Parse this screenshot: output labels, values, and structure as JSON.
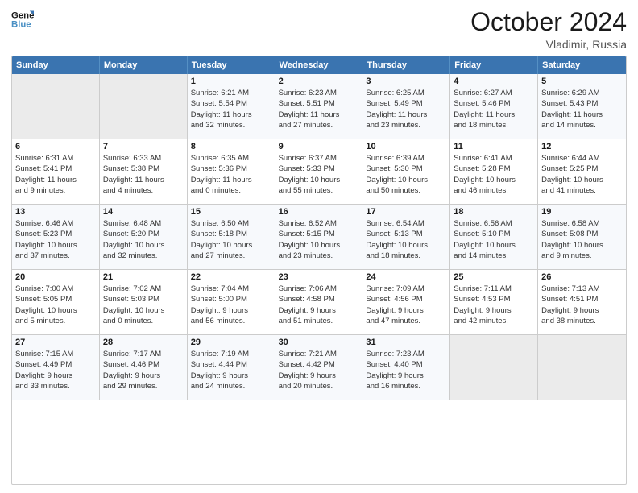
{
  "header": {
    "logo_line1": "General",
    "logo_line2": "Blue",
    "month": "October 2024",
    "location": "Vladimir, Russia"
  },
  "weekdays": [
    "Sunday",
    "Monday",
    "Tuesday",
    "Wednesday",
    "Thursday",
    "Friday",
    "Saturday"
  ],
  "weeks": [
    [
      {
        "day": "",
        "info": ""
      },
      {
        "day": "",
        "info": ""
      },
      {
        "day": "1",
        "info": "Sunrise: 6:21 AM\nSunset: 5:54 PM\nDaylight: 11 hours\nand 32 minutes."
      },
      {
        "day": "2",
        "info": "Sunrise: 6:23 AM\nSunset: 5:51 PM\nDaylight: 11 hours\nand 27 minutes."
      },
      {
        "day": "3",
        "info": "Sunrise: 6:25 AM\nSunset: 5:49 PM\nDaylight: 11 hours\nand 23 minutes."
      },
      {
        "day": "4",
        "info": "Sunrise: 6:27 AM\nSunset: 5:46 PM\nDaylight: 11 hours\nand 18 minutes."
      },
      {
        "day": "5",
        "info": "Sunrise: 6:29 AM\nSunset: 5:43 PM\nDaylight: 11 hours\nand 14 minutes."
      }
    ],
    [
      {
        "day": "6",
        "info": "Sunrise: 6:31 AM\nSunset: 5:41 PM\nDaylight: 11 hours\nand 9 minutes."
      },
      {
        "day": "7",
        "info": "Sunrise: 6:33 AM\nSunset: 5:38 PM\nDaylight: 11 hours\nand 4 minutes."
      },
      {
        "day": "8",
        "info": "Sunrise: 6:35 AM\nSunset: 5:36 PM\nDaylight: 11 hours\nand 0 minutes."
      },
      {
        "day": "9",
        "info": "Sunrise: 6:37 AM\nSunset: 5:33 PM\nDaylight: 10 hours\nand 55 minutes."
      },
      {
        "day": "10",
        "info": "Sunrise: 6:39 AM\nSunset: 5:30 PM\nDaylight: 10 hours\nand 50 minutes."
      },
      {
        "day": "11",
        "info": "Sunrise: 6:41 AM\nSunset: 5:28 PM\nDaylight: 10 hours\nand 46 minutes."
      },
      {
        "day": "12",
        "info": "Sunrise: 6:44 AM\nSunset: 5:25 PM\nDaylight: 10 hours\nand 41 minutes."
      }
    ],
    [
      {
        "day": "13",
        "info": "Sunrise: 6:46 AM\nSunset: 5:23 PM\nDaylight: 10 hours\nand 37 minutes."
      },
      {
        "day": "14",
        "info": "Sunrise: 6:48 AM\nSunset: 5:20 PM\nDaylight: 10 hours\nand 32 minutes."
      },
      {
        "day": "15",
        "info": "Sunrise: 6:50 AM\nSunset: 5:18 PM\nDaylight: 10 hours\nand 27 minutes."
      },
      {
        "day": "16",
        "info": "Sunrise: 6:52 AM\nSunset: 5:15 PM\nDaylight: 10 hours\nand 23 minutes."
      },
      {
        "day": "17",
        "info": "Sunrise: 6:54 AM\nSunset: 5:13 PM\nDaylight: 10 hours\nand 18 minutes."
      },
      {
        "day": "18",
        "info": "Sunrise: 6:56 AM\nSunset: 5:10 PM\nDaylight: 10 hours\nand 14 minutes."
      },
      {
        "day": "19",
        "info": "Sunrise: 6:58 AM\nSunset: 5:08 PM\nDaylight: 10 hours\nand 9 minutes."
      }
    ],
    [
      {
        "day": "20",
        "info": "Sunrise: 7:00 AM\nSunset: 5:05 PM\nDaylight: 10 hours\nand 5 minutes."
      },
      {
        "day": "21",
        "info": "Sunrise: 7:02 AM\nSunset: 5:03 PM\nDaylight: 10 hours\nand 0 minutes."
      },
      {
        "day": "22",
        "info": "Sunrise: 7:04 AM\nSunset: 5:00 PM\nDaylight: 9 hours\nand 56 minutes."
      },
      {
        "day": "23",
        "info": "Sunrise: 7:06 AM\nSunset: 4:58 PM\nDaylight: 9 hours\nand 51 minutes."
      },
      {
        "day": "24",
        "info": "Sunrise: 7:09 AM\nSunset: 4:56 PM\nDaylight: 9 hours\nand 47 minutes."
      },
      {
        "day": "25",
        "info": "Sunrise: 7:11 AM\nSunset: 4:53 PM\nDaylight: 9 hours\nand 42 minutes."
      },
      {
        "day": "26",
        "info": "Sunrise: 7:13 AM\nSunset: 4:51 PM\nDaylight: 9 hours\nand 38 minutes."
      }
    ],
    [
      {
        "day": "27",
        "info": "Sunrise: 7:15 AM\nSunset: 4:49 PM\nDaylight: 9 hours\nand 33 minutes."
      },
      {
        "day": "28",
        "info": "Sunrise: 7:17 AM\nSunset: 4:46 PM\nDaylight: 9 hours\nand 29 minutes."
      },
      {
        "day": "29",
        "info": "Sunrise: 7:19 AM\nSunset: 4:44 PM\nDaylight: 9 hours\nand 24 minutes."
      },
      {
        "day": "30",
        "info": "Sunrise: 7:21 AM\nSunset: 4:42 PM\nDaylight: 9 hours\nand 20 minutes."
      },
      {
        "day": "31",
        "info": "Sunrise: 7:23 AM\nSunset: 4:40 PM\nDaylight: 9 hours\nand 16 minutes."
      },
      {
        "day": "",
        "info": ""
      },
      {
        "day": "",
        "info": ""
      }
    ]
  ]
}
